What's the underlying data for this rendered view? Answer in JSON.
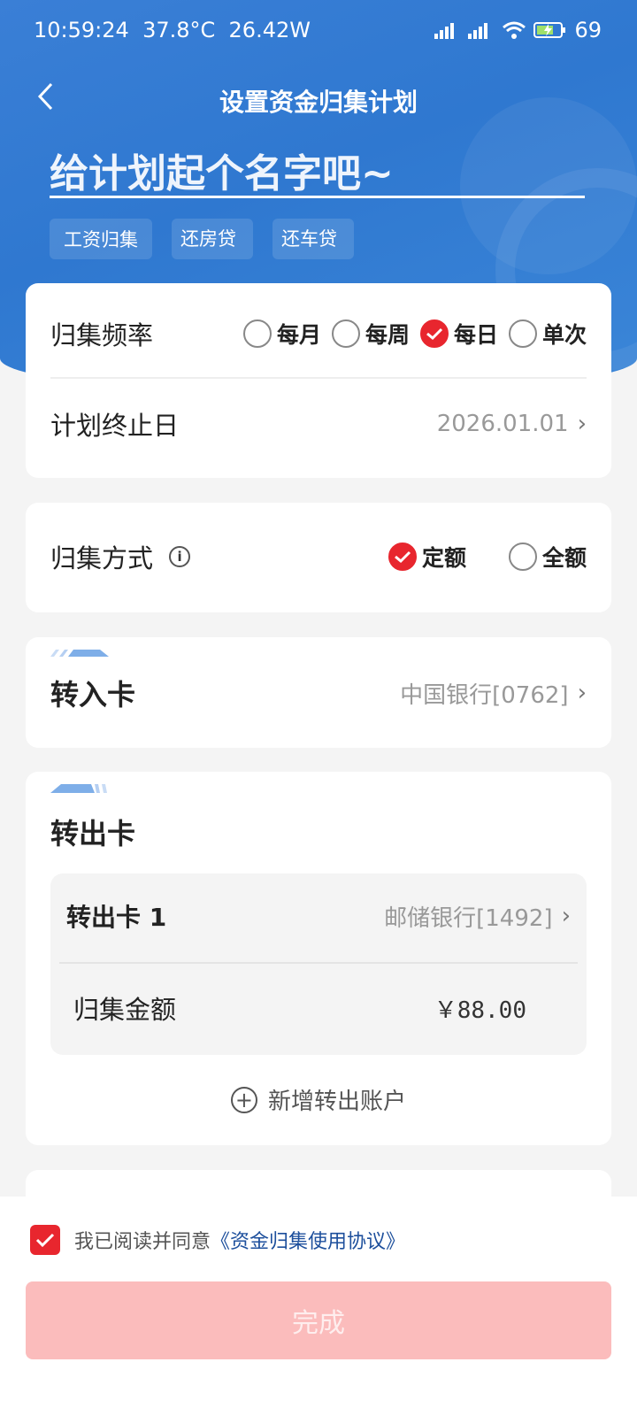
{
  "status_bar": {
    "time": "10:59:24",
    "temperature": "37.8°C",
    "power": "26.42W",
    "battery": "69"
  },
  "nav": {
    "back_icon": "chevron-left-icon",
    "title": "设置资金归集计划"
  },
  "plan_name": {
    "placeholder": "给计划起个名字吧~",
    "tags": [
      "工资归集",
      "还房贷",
      "还车贷"
    ]
  },
  "frequency": {
    "label": "归集频率",
    "options": [
      {
        "label": "每月",
        "selected": false
      },
      {
        "label": "每周",
        "selected": false
      },
      {
        "label": "每日",
        "selected": true
      },
      {
        "label": "单次",
        "selected": false
      }
    ]
  },
  "end_date": {
    "label": "计划终止日",
    "value": "2026.01.01"
  },
  "method": {
    "label": "归集方式",
    "options": [
      {
        "label": "定额",
        "selected": true
      },
      {
        "label": "全额",
        "selected": false
      }
    ]
  },
  "transfer_in": {
    "label": "转入卡",
    "value": "中国银行[0762]"
  },
  "transfer_out": {
    "label": "转出卡",
    "card_label": "转出卡 1",
    "card_value": "邮储银行[1492]",
    "amount_label": "归集金额",
    "amount_value": "￥88.00",
    "add_label": "新增转出账户"
  },
  "agreement": {
    "checked": true,
    "text": "我已阅读并同意",
    "link": "《资金归集使用协议》"
  },
  "done_button": "完成",
  "colors": {
    "primary_blue": "#2f78d0",
    "accent_red": "#e8262e",
    "disabled_button": "#fbbcbc",
    "link_blue": "#1d4f9c"
  }
}
